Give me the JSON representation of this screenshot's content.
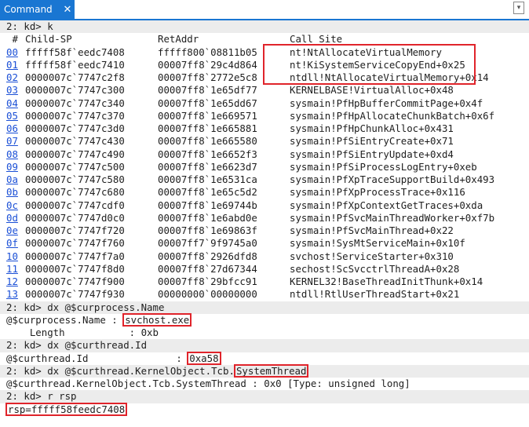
{
  "window": {
    "tab_label": "Command",
    "close_glyph": "✕",
    "more_glyph": "▾"
  },
  "stack": {
    "prompt": "2: kd> k",
    "header": {
      "idx": " #",
      "child_sp": "Child-SP",
      "ret_addr": "RetAddr",
      "call_site": "Call Site"
    },
    "frames": [
      {
        "idx": "00",
        "sp": "fffff58f`eedc7408",
        "ret": "fffff800`08811b05",
        "site": "nt!NtAllocateVirtualMemory"
      },
      {
        "idx": "01",
        "sp": "fffff58f`eedc7410",
        "ret": "00007ff8`29c4d864",
        "site": "nt!KiSystemServiceCopyEnd+0x25"
      },
      {
        "idx": "02",
        "sp": "0000007c`7747c2f8",
        "ret": "00007ff8`2772e5c8",
        "site": "ntdll!NtAllocateVirtualMemory+0x14"
      },
      {
        "idx": "03",
        "sp": "0000007c`7747c300",
        "ret": "00007ff8`1e65df77",
        "site": "KERNELBASE!VirtualAlloc+0x48"
      },
      {
        "idx": "04",
        "sp": "0000007c`7747c340",
        "ret": "00007ff8`1e65dd67",
        "site": "sysmain!PfHpBufferCommitPage+0x4f"
      },
      {
        "idx": "05",
        "sp": "0000007c`7747c370",
        "ret": "00007ff8`1e669571",
        "site": "sysmain!PfHpAllocateChunkBatch+0x6f"
      },
      {
        "idx": "06",
        "sp": "0000007c`7747c3d0",
        "ret": "00007ff8`1e665881",
        "site": "sysmain!PfHpChunkAlloc+0x431"
      },
      {
        "idx": "07",
        "sp": "0000007c`7747c430",
        "ret": "00007ff8`1e665580",
        "site": "sysmain!PfSiEntryCreate+0x71"
      },
      {
        "idx": "08",
        "sp": "0000007c`7747c490",
        "ret": "00007ff8`1e6652f3",
        "site": "sysmain!PfSiEntryUpdate+0xd4"
      },
      {
        "idx": "09",
        "sp": "0000007c`7747c500",
        "ret": "00007ff8`1e6623d7",
        "site": "sysmain!PfSiProcessLogEntry+0xeb"
      },
      {
        "idx": "0a",
        "sp": "0000007c`7747c580",
        "ret": "00007ff8`1e6531ca",
        "site": "sysmain!PfXpTraceSupportBuild+0x493"
      },
      {
        "idx": "0b",
        "sp": "0000007c`7747c680",
        "ret": "00007ff8`1e65c5d2",
        "site": "sysmain!PfXpProcessTrace+0x116"
      },
      {
        "idx": "0c",
        "sp": "0000007c`7747cdf0",
        "ret": "00007ff8`1e69744b",
        "site": "sysmain!PfXpContextGetTraces+0xda"
      },
      {
        "idx": "0d",
        "sp": "0000007c`7747d0c0",
        "ret": "00007ff8`1e6abd0e",
        "site": "sysmain!PfSvcMainThreadWorker+0xf7b"
      },
      {
        "idx": "0e",
        "sp": "0000007c`7747f720",
        "ret": "00007ff8`1e69863f",
        "site": "sysmain!PfSvcMainThread+0x22"
      },
      {
        "idx": "0f",
        "sp": "0000007c`7747f760",
        "ret": "00007ff7`9f9745a0",
        "site": "sysmain!SysMtServiceMain+0x10f"
      },
      {
        "idx": "10",
        "sp": "0000007c`7747f7a0",
        "ret": "00007ff8`2926dfd8",
        "site": "svchost!ServiceStarter+0x310"
      },
      {
        "idx": "11",
        "sp": "0000007c`7747f8d0",
        "ret": "00007ff8`27d67344",
        "site": "sechost!ScSvcctrlThreadA+0x28"
      },
      {
        "idx": "12",
        "sp": "0000007c`7747f900",
        "ret": "00007ff8`29bfcc91",
        "site": "KERNEL32!BaseThreadInitThunk+0x14"
      },
      {
        "idx": "13",
        "sp": "0000007c`7747f930",
        "ret": "00000000`00000000",
        "site": "ntdll!RtlUserThreadStart+0x21"
      }
    ]
  },
  "dx_name": {
    "cmd": "2: kd> dx @$curprocess.Name",
    "label": "@$curprocess.Name : ",
    "value": "svchost.exe",
    "sub": "    Length           : 0xb"
  },
  "dx_thread_id": {
    "cmd": "2: kd> dx @$curthread.Id",
    "label": "@$curthread.Id               : ",
    "value": "0xa58"
  },
  "dx_system_thread": {
    "cmd_prefix": "2: kd> dx @$curthread.KernelObject.Tcb.",
    "cmd_highlight": "SystemThread",
    "result": "@$curthread.KernelObject.Tcb.SystemThread : 0x0 [Type: unsigned long]"
  },
  "r_rsp": {
    "cmd": "2: kd> r rsp",
    "value": "rsp=fffff58feedc7408"
  },
  "colors": {
    "accent": "#1976d2",
    "highlight_box": "#e0242b",
    "link": "#1a4fd6",
    "command_bg": "#ececec"
  }
}
